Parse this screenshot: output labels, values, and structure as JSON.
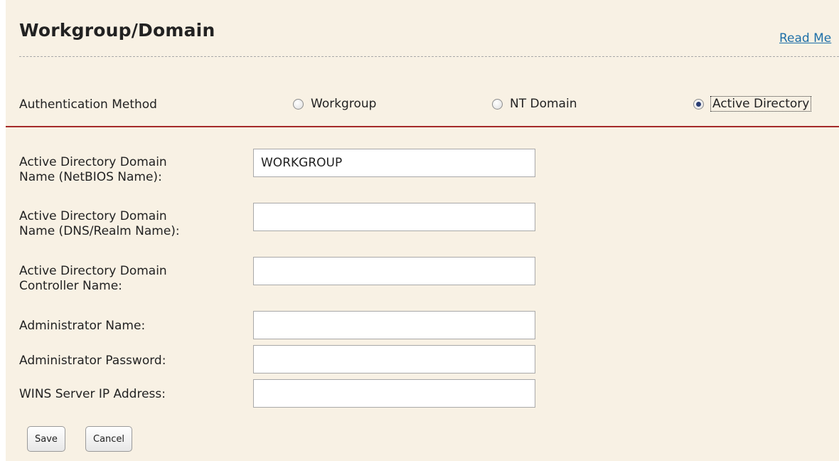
{
  "page": {
    "title": "Workgroup/Domain",
    "read_link": "Read Me"
  },
  "auth": {
    "label": "Authentication Method",
    "options": [
      {
        "label": "Workgroup",
        "checked": false
      },
      {
        "label": "NT Domain",
        "checked": false
      },
      {
        "label": "Active Directory",
        "checked": true
      }
    ]
  },
  "fields": {
    "netbios": {
      "label_line1": "Active Directory Domain",
      "label_line2": "Name (NetBIOS Name):",
      "value": "WORKGROUP"
    },
    "dns": {
      "label_line1": "Active Directory Domain",
      "label_line2": "Name (DNS/Realm Name):",
      "value": ""
    },
    "controller": {
      "label_line1": "Active Directory Domain",
      "label_line2": "Controller Name:",
      "value": ""
    },
    "admin_name": {
      "label": "Administrator Name:",
      "value": ""
    },
    "admin_password": {
      "label": "Administrator Password:",
      "value": ""
    },
    "wins": {
      "label": "WINS Server IP Address:",
      "value": ""
    }
  },
  "buttons": {
    "save": "Save",
    "cancel": "Cancel"
  },
  "colors": {
    "background": "#f8f1e4",
    "separator_red": "#a52a2a",
    "link": "#1d6fa8"
  }
}
